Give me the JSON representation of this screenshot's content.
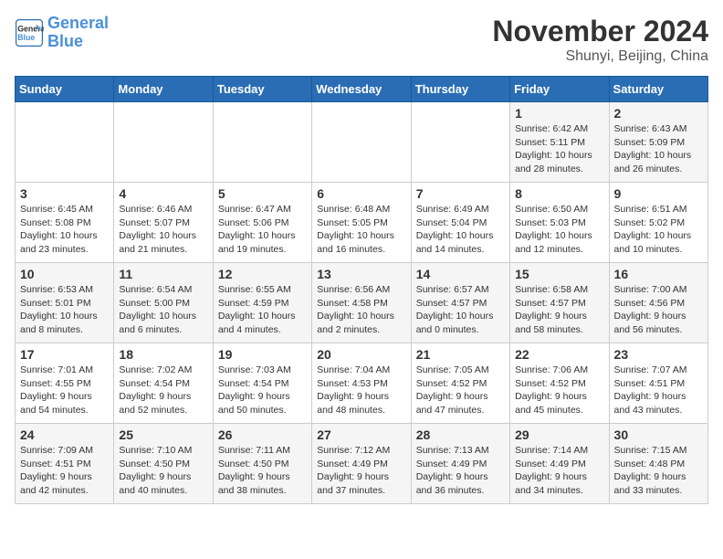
{
  "header": {
    "logo_line1": "General",
    "logo_line2": "Blue",
    "month": "November 2024",
    "location": "Shunyi, Beijing, China"
  },
  "days_of_week": [
    "Sunday",
    "Monday",
    "Tuesday",
    "Wednesday",
    "Thursday",
    "Friday",
    "Saturday"
  ],
  "weeks": [
    [
      {
        "day": "",
        "info": ""
      },
      {
        "day": "",
        "info": ""
      },
      {
        "day": "",
        "info": ""
      },
      {
        "day": "",
        "info": ""
      },
      {
        "day": "",
        "info": ""
      },
      {
        "day": "1",
        "info": "Sunrise: 6:42 AM\nSunset: 5:11 PM\nDaylight: 10 hours\nand 28 minutes."
      },
      {
        "day": "2",
        "info": "Sunrise: 6:43 AM\nSunset: 5:09 PM\nDaylight: 10 hours\nand 26 minutes."
      }
    ],
    [
      {
        "day": "3",
        "info": "Sunrise: 6:45 AM\nSunset: 5:08 PM\nDaylight: 10 hours\nand 23 minutes."
      },
      {
        "day": "4",
        "info": "Sunrise: 6:46 AM\nSunset: 5:07 PM\nDaylight: 10 hours\nand 21 minutes."
      },
      {
        "day": "5",
        "info": "Sunrise: 6:47 AM\nSunset: 5:06 PM\nDaylight: 10 hours\nand 19 minutes."
      },
      {
        "day": "6",
        "info": "Sunrise: 6:48 AM\nSunset: 5:05 PM\nDaylight: 10 hours\nand 16 minutes."
      },
      {
        "day": "7",
        "info": "Sunrise: 6:49 AM\nSunset: 5:04 PM\nDaylight: 10 hours\nand 14 minutes."
      },
      {
        "day": "8",
        "info": "Sunrise: 6:50 AM\nSunset: 5:03 PM\nDaylight: 10 hours\nand 12 minutes."
      },
      {
        "day": "9",
        "info": "Sunrise: 6:51 AM\nSunset: 5:02 PM\nDaylight: 10 hours\nand 10 minutes."
      }
    ],
    [
      {
        "day": "10",
        "info": "Sunrise: 6:53 AM\nSunset: 5:01 PM\nDaylight: 10 hours\nand 8 minutes."
      },
      {
        "day": "11",
        "info": "Sunrise: 6:54 AM\nSunset: 5:00 PM\nDaylight: 10 hours\nand 6 minutes."
      },
      {
        "day": "12",
        "info": "Sunrise: 6:55 AM\nSunset: 4:59 PM\nDaylight: 10 hours\nand 4 minutes."
      },
      {
        "day": "13",
        "info": "Sunrise: 6:56 AM\nSunset: 4:58 PM\nDaylight: 10 hours\nand 2 minutes."
      },
      {
        "day": "14",
        "info": "Sunrise: 6:57 AM\nSunset: 4:57 PM\nDaylight: 10 hours\nand 0 minutes."
      },
      {
        "day": "15",
        "info": "Sunrise: 6:58 AM\nSunset: 4:57 PM\nDaylight: 9 hours\nand 58 minutes."
      },
      {
        "day": "16",
        "info": "Sunrise: 7:00 AM\nSunset: 4:56 PM\nDaylight: 9 hours\nand 56 minutes."
      }
    ],
    [
      {
        "day": "17",
        "info": "Sunrise: 7:01 AM\nSunset: 4:55 PM\nDaylight: 9 hours\nand 54 minutes."
      },
      {
        "day": "18",
        "info": "Sunrise: 7:02 AM\nSunset: 4:54 PM\nDaylight: 9 hours\nand 52 minutes."
      },
      {
        "day": "19",
        "info": "Sunrise: 7:03 AM\nSunset: 4:54 PM\nDaylight: 9 hours\nand 50 minutes."
      },
      {
        "day": "20",
        "info": "Sunrise: 7:04 AM\nSunset: 4:53 PM\nDaylight: 9 hours\nand 48 minutes."
      },
      {
        "day": "21",
        "info": "Sunrise: 7:05 AM\nSunset: 4:52 PM\nDaylight: 9 hours\nand 47 minutes."
      },
      {
        "day": "22",
        "info": "Sunrise: 7:06 AM\nSunset: 4:52 PM\nDaylight: 9 hours\nand 45 minutes."
      },
      {
        "day": "23",
        "info": "Sunrise: 7:07 AM\nSunset: 4:51 PM\nDaylight: 9 hours\nand 43 minutes."
      }
    ],
    [
      {
        "day": "24",
        "info": "Sunrise: 7:09 AM\nSunset: 4:51 PM\nDaylight: 9 hours\nand 42 minutes."
      },
      {
        "day": "25",
        "info": "Sunrise: 7:10 AM\nSunset: 4:50 PM\nDaylight: 9 hours\nand 40 minutes."
      },
      {
        "day": "26",
        "info": "Sunrise: 7:11 AM\nSunset: 4:50 PM\nDaylight: 9 hours\nand 38 minutes."
      },
      {
        "day": "27",
        "info": "Sunrise: 7:12 AM\nSunset: 4:49 PM\nDaylight: 9 hours\nand 37 minutes."
      },
      {
        "day": "28",
        "info": "Sunrise: 7:13 AM\nSunset: 4:49 PM\nDaylight: 9 hours\nand 36 minutes."
      },
      {
        "day": "29",
        "info": "Sunrise: 7:14 AM\nSunset: 4:49 PM\nDaylight: 9 hours\nand 34 minutes."
      },
      {
        "day": "30",
        "info": "Sunrise: 7:15 AM\nSunset: 4:48 PM\nDaylight: 9 hours\nand 33 minutes."
      }
    ]
  ]
}
